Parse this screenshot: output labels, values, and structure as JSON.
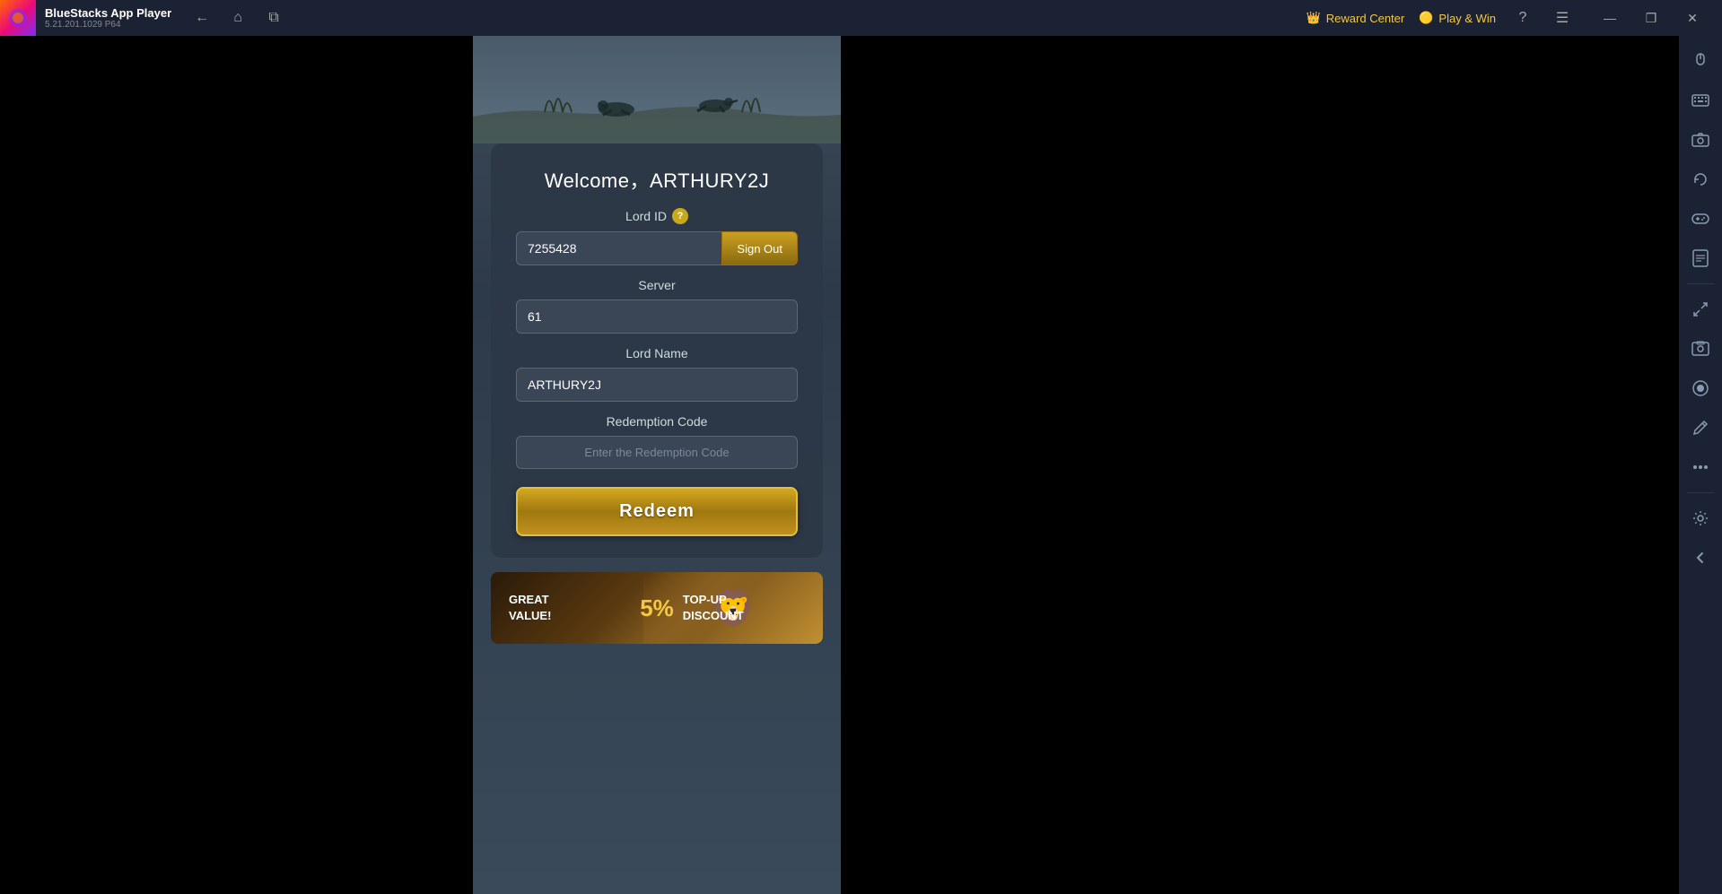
{
  "titleBar": {
    "appName": "BlueStacks App Player",
    "appVersion": "5.21.201.1029  P64",
    "rewardCenter": "Reward Center",
    "playWin": "Play & Win"
  },
  "winControls": {
    "minimize": "—",
    "maximize": "❐",
    "close": "✕"
  },
  "form": {
    "welcomeText": "Welcome，ARTHURY2J",
    "lordIdLabel": "Lord ID",
    "lordIdValue": "7255428",
    "signOutLabel": "Sign Out",
    "serverLabel": "Server",
    "serverValue": "61",
    "lordNameLabel": "Lord Name",
    "lordNameValue": "ARTHURY2J",
    "redemptionCodeLabel": "Redemption Code",
    "redemptionCodePlaceholder": "Enter the Redemption Code",
    "redeemLabel": "Redeem"
  },
  "banner": {
    "greatValue": "GREAT",
    "value": "VALUE!",
    "percent": "5%",
    "topUp": "TOP-UP",
    "discount": "DISCOUNT"
  },
  "sidebar": {
    "icons": [
      {
        "name": "mouse-icon",
        "glyph": "⊙"
      },
      {
        "name": "keyboard-icon",
        "glyph": "⌨"
      },
      {
        "name": "camera-icon",
        "glyph": "📷"
      },
      {
        "name": "rotate-icon",
        "glyph": "↺"
      },
      {
        "name": "controller-icon",
        "glyph": "🎮"
      },
      {
        "name": "apk-icon",
        "glyph": "▦"
      },
      {
        "name": "resize-icon",
        "glyph": "⤢"
      },
      {
        "name": "screenshot-icon",
        "glyph": "📸"
      },
      {
        "name": "record-icon",
        "glyph": "⏺"
      },
      {
        "name": "edit-icon",
        "glyph": "✏"
      },
      {
        "name": "more-icon",
        "glyph": "•••"
      },
      {
        "name": "settings-icon",
        "glyph": "⚙"
      },
      {
        "name": "back-icon",
        "glyph": "←"
      }
    ]
  }
}
